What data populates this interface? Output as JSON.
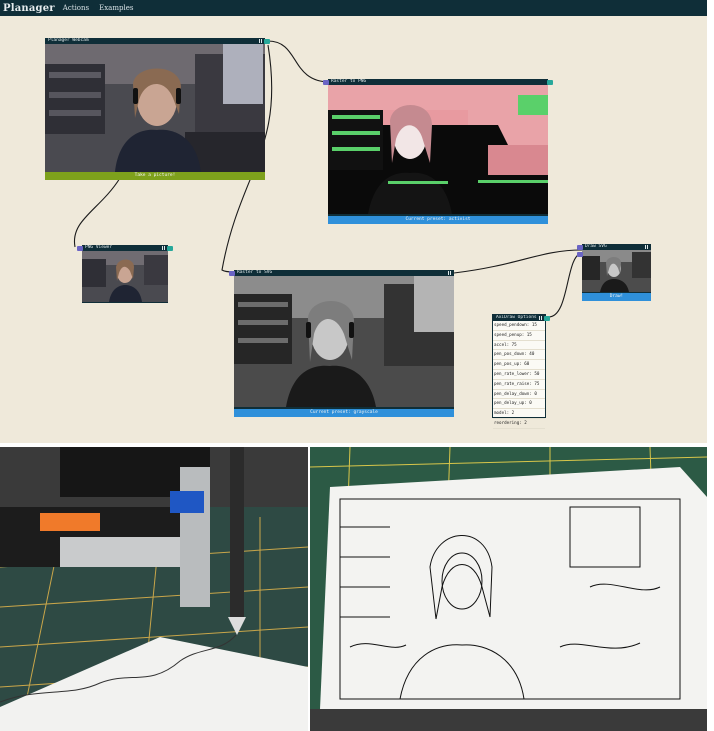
{
  "app": {
    "brand": "Planager",
    "menu": [
      "Actions",
      "Examples"
    ]
  },
  "nodes": {
    "webcam": {
      "title": "Planager Webcam",
      "footer": "Take a picture!"
    },
    "raster_png": {
      "title": "Raster to PNG",
      "footer": "Current preset: activist"
    },
    "png_viewer": {
      "title": "PNG Viewer"
    },
    "raster_svg": {
      "title": "Raster to SVG",
      "footer": "Current preset: grayscale"
    },
    "draw_svg": {
      "title": "Draw SVG",
      "footer": "Draw!"
    },
    "axidraw": {
      "title": "AxiDraw Options",
      "params": [
        "speed_pendown: 15",
        "speed_penup: 15",
        "accel: 75",
        "pen_pos_down: 40",
        "pen_pos_up: 60",
        "pen_rate_lower: 50",
        "pen_rate_raise: 75",
        "pen_delay_down: 0",
        "pen_delay_up: 0",
        "model: 2",
        "reordering: 2"
      ]
    }
  },
  "colors": {
    "canvas": "#efe9da",
    "node_frame": "#0f2e38",
    "footer_green": "#7ea11c",
    "footer_blue": "#2f90da",
    "port_in": "#6a64c4",
    "port_out": "#27a89a"
  }
}
